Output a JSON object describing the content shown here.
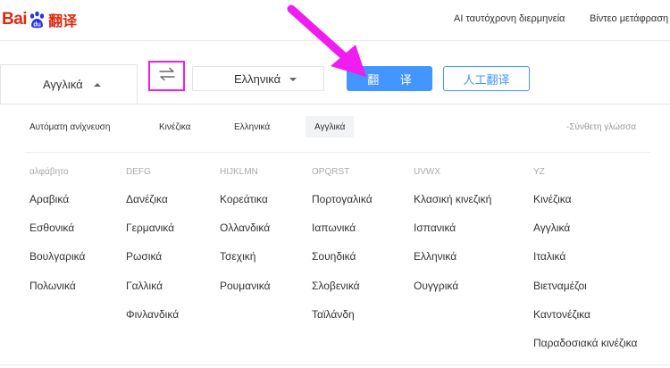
{
  "header": {
    "logo_latin": "Bai",
    "logo_cn": "翻译",
    "links": [
      "AI ταυτόχρονη διερμηνεία",
      "Βίντεο μετάφραση"
    ]
  },
  "toolbar": {
    "source_lang": "Αγγλικά",
    "target_lang": "Ελληνικά",
    "translate_label": "翻 译",
    "human_label": "人工翻译"
  },
  "quick": {
    "auto": "Αυτόματη ανίχνευση",
    "zh": "Κινέζικα",
    "el": "Ελληνικά",
    "en": "Αγγλικά",
    "mixed": "-Σύνθετη γλώσσα"
  },
  "columns": [
    {
      "head": "αλφάβητο",
      "items": [
        "Αραβικά",
        "Εσθονικά",
        "Βουλγαρικά",
        "Πολωνικά"
      ]
    },
    {
      "head": "DEFG",
      "items": [
        "Δανέζικα",
        "Γερμανικά",
        "Ρωσικά",
        "Γαλλικά",
        "Φινλανδικά"
      ]
    },
    {
      "head": "HIJKLMN",
      "items": [
        "Κορεάτικα",
        "Ολλανδικά",
        "Τσεχική",
        "Ρουμανικά"
      ]
    },
    {
      "head": "OPQRST",
      "items": [
        "Πορτογαλικά",
        "Ιαπωνικά",
        "Σουηδικά",
        "Σλοβενικά",
        "Ταϊλάνδη"
      ]
    },
    {
      "head": "UVWX",
      "items": [
        "Κλασική κινεζική",
        "Ισπανικά",
        "Ελληνικά",
        "Ουγγρικά"
      ]
    },
    {
      "head": "YZ",
      "items": [
        "Κινέζικα",
        "Αγγλικά",
        "Ιταλικά",
        "Βιετναμέζοι",
        "Καντονέζικα",
        "Παραδοσιακά κινέζικα"
      ]
    }
  ],
  "colors": {
    "brand_red": "#de2910",
    "brand_blue": "#2932e1",
    "accent_blue": "#4395ff",
    "highlight_magenta": "#f01cf0"
  },
  "icons": {
    "swap": "swap-arrows-icon",
    "paw": "baidu-paw-icon"
  }
}
